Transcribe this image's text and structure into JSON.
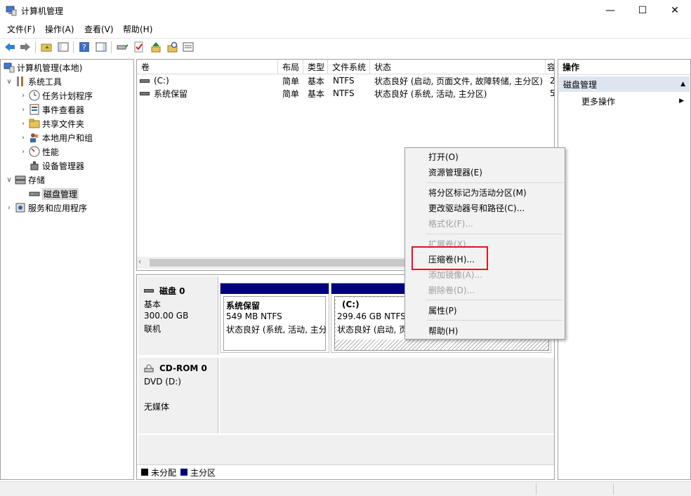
{
  "window": {
    "title": "计算机管理",
    "minimize_glyph": "—",
    "maximize_glyph": "☐",
    "close_glyph": "✕"
  },
  "menu": [
    "文件(F)",
    "操作(A)",
    "查看(V)",
    "帮助(H)"
  ],
  "tree": {
    "root": "计算机管理(本地)",
    "system_tools": "系统工具",
    "task_scheduler": "任务计划程序",
    "event_viewer": "事件查看器",
    "shared_folders": "共享文件夹",
    "local_users": "本地用户和组",
    "performance": "性能",
    "device_manager": "设备管理器",
    "storage": "存储",
    "disk_management": "磁盘管理",
    "services_apps": "服务和应用程序"
  },
  "volumes": {
    "headers": [
      "卷",
      "布局",
      "类型",
      "文件系统",
      "状态",
      "容"
    ],
    "rows": [
      {
        "name": "(C:)",
        "layout": "简单",
        "type": "基本",
        "fs": "NTFS",
        "status": "状态良好 (启动, 页面文件, 故障转储, 主分区)",
        "cap": "2"
      },
      {
        "name": "系统保留",
        "layout": "简单",
        "type": "基本",
        "fs": "NTFS",
        "status": "状态良好 (系统, 活动, 主分区)",
        "cap": "5"
      }
    ]
  },
  "disks": {
    "disk0": {
      "name": "磁盘 0",
      "type": "基本",
      "size": "300.00 GB",
      "state": "联机"
    },
    "part1": {
      "name": "系统保留",
      "size": "549 MB NTFS",
      "status": "状态良好 (系统, 活动, 主分",
      "color": "#000080"
    },
    "part2": {
      "name": "(C:)",
      "size": "299.46 GB NTFS",
      "status": "状态良好 (启动, 页",
      "color": "#000080"
    },
    "cdrom": {
      "name": "CD-ROM 0",
      "type": "DVD (D:)",
      "state": "无媒体"
    }
  },
  "legend": {
    "unallocated": "未分配",
    "primary": "主分区",
    "unallocated_color": "#000000",
    "primary_color": "#000080"
  },
  "actions": {
    "header": "操作",
    "section": "磁盘管理",
    "more": "更多操作"
  },
  "context_menu": {
    "open": "打开(O)",
    "explore": "资源管理器(E)",
    "mark_active": "将分区标记为活动分区(M)",
    "change_letter": "更改驱动器号和路径(C)...",
    "format": "格式化(F)...",
    "extend": "扩展卷(X)...",
    "shrink": "压缩卷(H)...",
    "add_mirror": "添加镜像(A)...",
    "delete": "删除卷(D)...",
    "properties": "属性(P)",
    "help": "帮助(H)"
  },
  "highlight_color": "#e81123"
}
